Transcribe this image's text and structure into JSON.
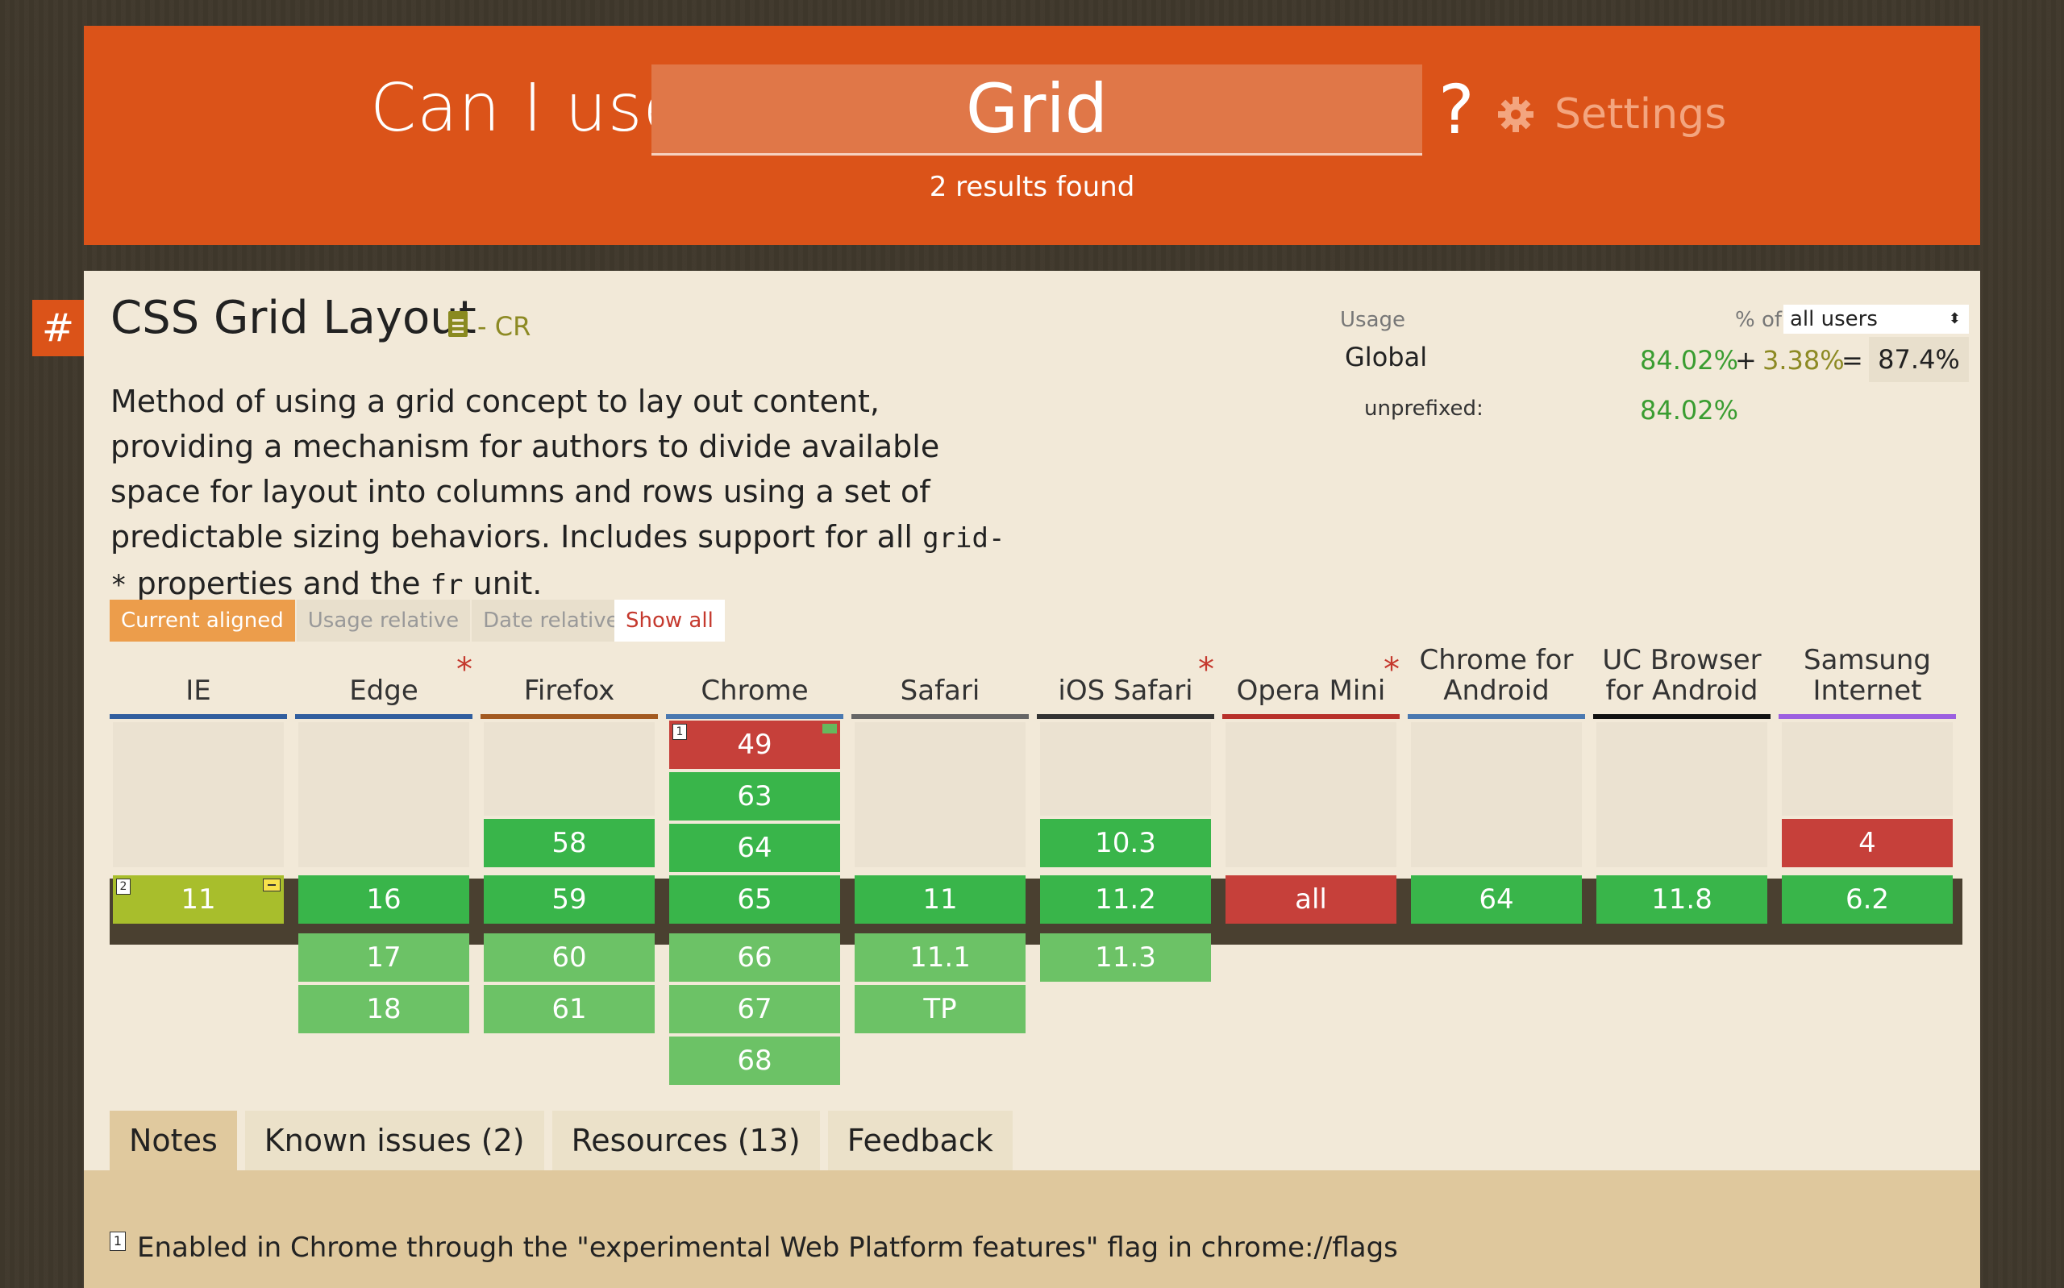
{
  "header": {
    "prefix": "Can I use",
    "query": "Grid",
    "suffix": "?",
    "settings_label": "Settings",
    "results": "2 results found"
  },
  "feature": {
    "hash": "#",
    "title": "CSS Grid Layout",
    "status": "- CR",
    "description": {
      "part1": "Method of using a grid concept to lay out content, providing a mechanism for authors to divide available space for layout into columns and rows using a set of predictable sizing behaviors. Includes support for all ",
      "code1": "grid-*",
      "part2": " properties and the ",
      "code2": "fr",
      "part3": " unit."
    }
  },
  "usage": {
    "label": "Usage",
    "pct_of": "% of",
    "selected": "all users",
    "global_label": "Global",
    "supported": "84.02%",
    "plus": "+",
    "partial": "3.38%",
    "equals": "=",
    "total": "87.4%",
    "unprefixed_label": "unprefixed:",
    "unprefixed": "84.02%"
  },
  "views": [
    "Current aligned",
    "Usage relative",
    "Date relative"
  ],
  "show_all": "Show all",
  "browsers": [
    {
      "name": "IE",
      "color": "#315e9e",
      "ast": ""
    },
    {
      "name": "Edge",
      "color": "#315e9e",
      "ast": "*"
    },
    {
      "name": "Firefox",
      "color": "#a35a20",
      "ast": ""
    },
    {
      "name": "Chrome",
      "color": "#4a78b0",
      "ast": ""
    },
    {
      "name": "Safari",
      "color": "#666666",
      "ast": ""
    },
    {
      "name": "iOS Safari",
      "color": "#333333",
      "ast": "*"
    },
    {
      "name": "Opera Mini",
      "color": "#b8302a",
      "ast": "*"
    },
    {
      "name": "Chrome for Android",
      "color": "#4a78b0",
      "ast": ""
    },
    {
      "name": "UC Browser for Android",
      "color": "#111111",
      "ast": ""
    },
    {
      "name": "Samsung Internet",
      "color": "#9c5fe0",
      "ast": ""
    }
  ],
  "versions": {
    "chrome_49": "49",
    "chrome_63": "63",
    "chrome_64": "64",
    "firefox_58": "58",
    "ios_103": "10.3",
    "samsung_4": "4",
    "ie_cur": "11",
    "edge_cur": "16",
    "firefox_cur": "59",
    "chrome_cur": "65",
    "safari_cur": "11",
    "ios_cur": "11.2",
    "opmini_cur": "all",
    "cfa_cur": "64",
    "uc_cur": "11.8",
    "samsung_cur": "6.2",
    "edge_17": "17",
    "edge_18": "18",
    "firefox_60": "60",
    "firefox_61": "61",
    "chrome_66": "66",
    "chrome_67": "67",
    "chrome_68": "68",
    "safari_111": "11.1",
    "safari_tp": "TP",
    "ios_113": "11.3",
    "note1": "1",
    "note2": "2"
  },
  "tabs": [
    "Notes",
    "Known issues (2)",
    "Resources (13)",
    "Feedback"
  ],
  "note": {
    "num": "1",
    "text": "Enabled in Chrome through the \"experimental Web Platform features\" flag in chrome://flags"
  }
}
